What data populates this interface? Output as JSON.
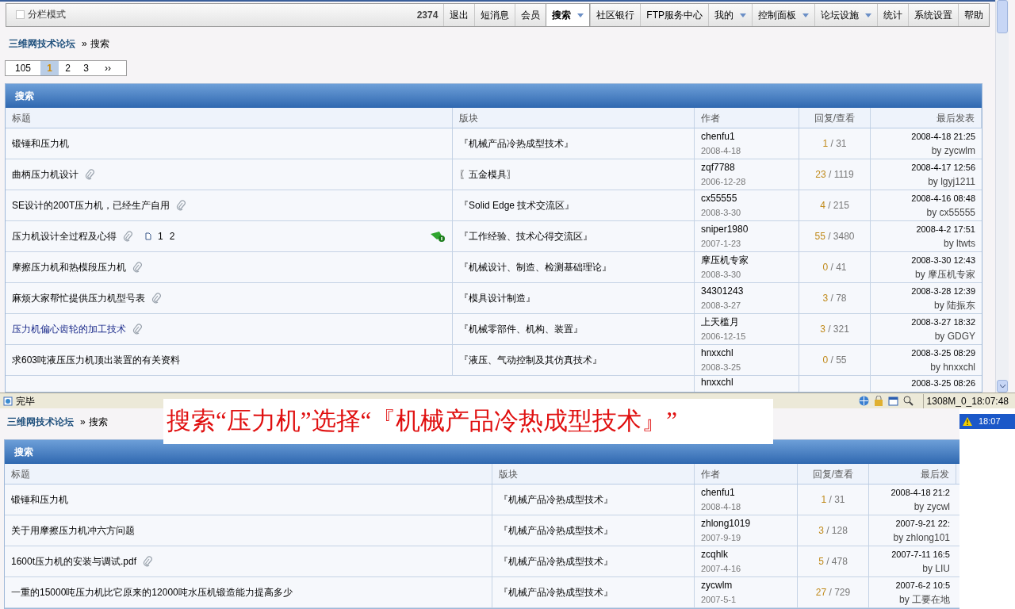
{
  "top_page": {
    "split_mode": {
      "label": "分栏模式",
      "checked": false
    },
    "nav": [
      {
        "label": "2374",
        "kind": "count",
        "selected": false,
        "dropdown": false
      },
      {
        "label": "退出",
        "kind": "link",
        "selected": false,
        "dropdown": false
      },
      {
        "label": "短消息",
        "kind": "link",
        "selected": false,
        "dropdown": false
      },
      {
        "label": "会员",
        "kind": "link",
        "selected": false,
        "dropdown": false
      },
      {
        "label": "搜索",
        "kind": "link",
        "selected": true,
        "dropdown": true
      },
      {
        "label": "社区银行",
        "kind": "link",
        "selected": false,
        "dropdown": false
      },
      {
        "label": "FTP服务中心",
        "kind": "link",
        "selected": false,
        "dropdown": false
      },
      {
        "label": "我的",
        "kind": "link",
        "selected": false,
        "dropdown": true
      },
      {
        "label": "控制面板",
        "kind": "link",
        "selected": false,
        "dropdown": true
      },
      {
        "label": "论坛设施",
        "kind": "link",
        "selected": false,
        "dropdown": true
      },
      {
        "label": "统计",
        "kind": "link",
        "selected": false,
        "dropdown": false
      },
      {
        "label": "系统设置",
        "kind": "link",
        "selected": false,
        "dropdown": false
      },
      {
        "label": "帮助",
        "kind": "link",
        "selected": false,
        "dropdown": false
      }
    ],
    "breadcrumb": {
      "home": "三维网技术论坛",
      "separator": "»",
      "current": "搜索"
    },
    "pager": {
      "total": "105",
      "pages": [
        {
          "label": "1",
          "selected": true
        },
        {
          "label": "2",
          "selected": false
        },
        {
          "label": "3",
          "selected": false
        }
      ],
      "next": "››"
    },
    "results": {
      "title": "搜索",
      "columns": [
        "标题",
        "版块",
        "作者",
        "回复/查看",
        "最后发表"
      ],
      "reply_separator": "/",
      "rows": [
        {
          "title": "锻锤和压力机",
          "visited": false,
          "attachment": false,
          "badge": false,
          "forum": "『机械产品冷热成型技术』",
          "author": "chenfu1",
          "date": "2008-4-18",
          "replies": "1",
          "views": "31",
          "last_time": "2008-4-18 21:25",
          "last_by": "by zycwlm"
        },
        {
          "title": "曲柄压力机设计",
          "visited": false,
          "attachment": true,
          "badge": false,
          "forum": "〖五金模具〗",
          "author": "zqf7788",
          "date": "2006-12-28",
          "replies": "23",
          "views": "1119",
          "last_time": "2008-4-17 12:56",
          "last_by": "by lgyj1211"
        },
        {
          "title": "SE设计的200T压力机，已经生产自用",
          "visited": false,
          "attachment": true,
          "badge": false,
          "forum": "『Solid Edge 技术交流区』",
          "author": "cx55555",
          "date": "2008-3-30",
          "replies": "4",
          "views": "215",
          "last_time": "2008-4-16 08:48",
          "last_by": "by cx55555"
        },
        {
          "title": "压力机设计全过程及心得",
          "visited": false,
          "attachment": true,
          "badge": true,
          "pages": [
            "1",
            "2"
          ],
          "forum": "『工作经验、技术心得交流区』",
          "author": "sniper1980",
          "date": "2007-1-23",
          "replies": "55",
          "views": "3480",
          "last_time": "2008-4-2 17:51",
          "last_by": "by ltwts"
        },
        {
          "title": "摩擦压力机和热模段压力机",
          "visited": false,
          "attachment": true,
          "badge": false,
          "forum": "『机械设计、制造、检测基础理论』",
          "author": "摩压机专家",
          "date": "2008-3-30",
          "replies": "0",
          "views": "41",
          "last_time": "2008-3-30 12:43",
          "last_by": "by 摩压机专家"
        },
        {
          "title": "麻烦大家帮忙提供压力机型号表",
          "visited": false,
          "attachment": true,
          "badge": false,
          "forum": "『模具设计制造』",
          "author": "34301243",
          "date": "2008-3-27",
          "replies": "3",
          "views": "78",
          "last_time": "2008-3-28 12:39",
          "last_by": "by 陆振东"
        },
        {
          "title": "压力机偏心齿轮的加工技术",
          "visited": true,
          "attachment": true,
          "badge": false,
          "forum": "『机械零部件、机构、装置』",
          "author": "上天槛月",
          "date": "2006-12-15",
          "replies": "3",
          "views": "321",
          "last_time": "2008-3-27 18:32",
          "last_by": "by GDGY"
        },
        {
          "title": "求603吨液压压力机顶出装置的有关资料",
          "visited": false,
          "attachment": false,
          "badge": false,
          "forum": "『液压、气动控制及其仿真技术』",
          "author": "hnxxchl",
          "date": "2008-3-25",
          "replies": "0",
          "views": "55",
          "last_time": "2008-3-25 08:29",
          "last_by": "by hnxxchl"
        }
      ],
      "partial_row": {
        "author": "hnxxchl",
        "last_time": "2008-3-25 08:26"
      }
    }
  },
  "status_bar": {
    "text": "完毕",
    "memory_clock": "1308M_0_18:07:48"
  },
  "taskbar": {
    "clock": "18:07"
  },
  "bottom_page": {
    "breadcrumb": {
      "home": "三维网技术论坛",
      "separator": "»",
      "current": "搜索"
    },
    "results": {
      "title": "搜索",
      "columns": [
        "标题",
        "版块",
        "作者",
        "回复/查看",
        "最后发"
      ],
      "reply_separator": "/",
      "rows": [
        {
          "title": "锻锤和压力机",
          "visited": false,
          "attachment": false,
          "badge": false,
          "forum": "『机械产品冷热成型技术』",
          "author": "chenfu1",
          "date": "2008-4-18",
          "replies": "1",
          "views": "31",
          "last_time": "2008-4-18 21:2",
          "last_by": "by zycwl"
        },
        {
          "title": "关于用摩擦压力机冲六方问题",
          "visited": false,
          "attachment": false,
          "badge": false,
          "forum": "『机械产品冷热成型技术』",
          "author": "zhlong1019",
          "date": "2007-9-19",
          "replies": "3",
          "views": "128",
          "last_time": "2007-9-21 22:",
          "last_by": "by zhlong101"
        },
        {
          "title": "1600t压力机的安装与调试.pdf",
          "visited": false,
          "attachment": true,
          "badge": false,
          "forum": "『机械产品冷热成型技术』",
          "author": "zcqhlk",
          "date": "2007-4-16",
          "replies": "5",
          "views": "478",
          "last_time": "2007-7-11 16:5",
          "last_by": "by LIU"
        },
        {
          "title": "一重的15000吨压力机比它原来的12000吨水压机锻造能力提高多少",
          "visited": false,
          "attachment": false,
          "badge": false,
          "forum": "『机械产品冷热成型技术』",
          "author": "zycwlm",
          "date": "2007-5-1",
          "replies": "27",
          "views": "729",
          "last_time": "2007-6-2 10:5",
          "last_by": "by 工要在地"
        }
      ]
    }
  },
  "caption": "搜索“压力机”选择“『机械产品冷热成型技术』”"
}
